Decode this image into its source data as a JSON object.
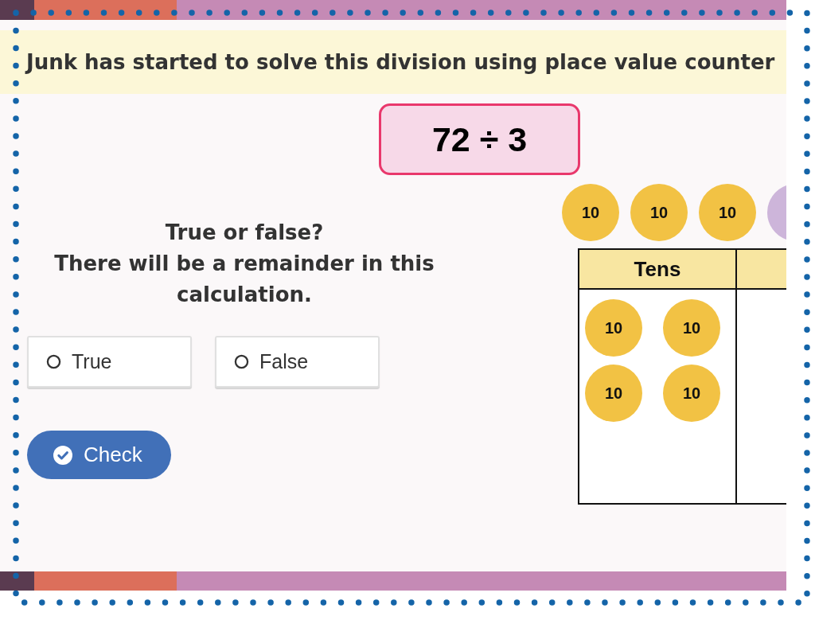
{
  "slide": {
    "headline": "Junk has started to solve this division using place value counter",
    "expression": "72 ÷ 3"
  },
  "question": {
    "prompt": "True or false?",
    "statement": "There will be a remainder in this calculation."
  },
  "options": [
    {
      "label": "True",
      "selected": false
    },
    {
      "label": "False",
      "selected": false
    }
  ],
  "check_button": {
    "label": "Check"
  },
  "counters": [
    {
      "label": "10",
      "color": "#f2c244",
      "cut_off": false
    },
    {
      "label": "10",
      "color": "#f2c244",
      "cut_off": false
    },
    {
      "label": "10",
      "color": "#f2c244",
      "cut_off": false
    },
    {
      "color": "#cdb5da",
      "cut_off": true
    }
  ],
  "place_value_chart": {
    "columns": [
      {
        "heading": "Tens",
        "counters": [
          "10",
          "10",
          "10",
          "10"
        ]
      }
    ]
  }
}
